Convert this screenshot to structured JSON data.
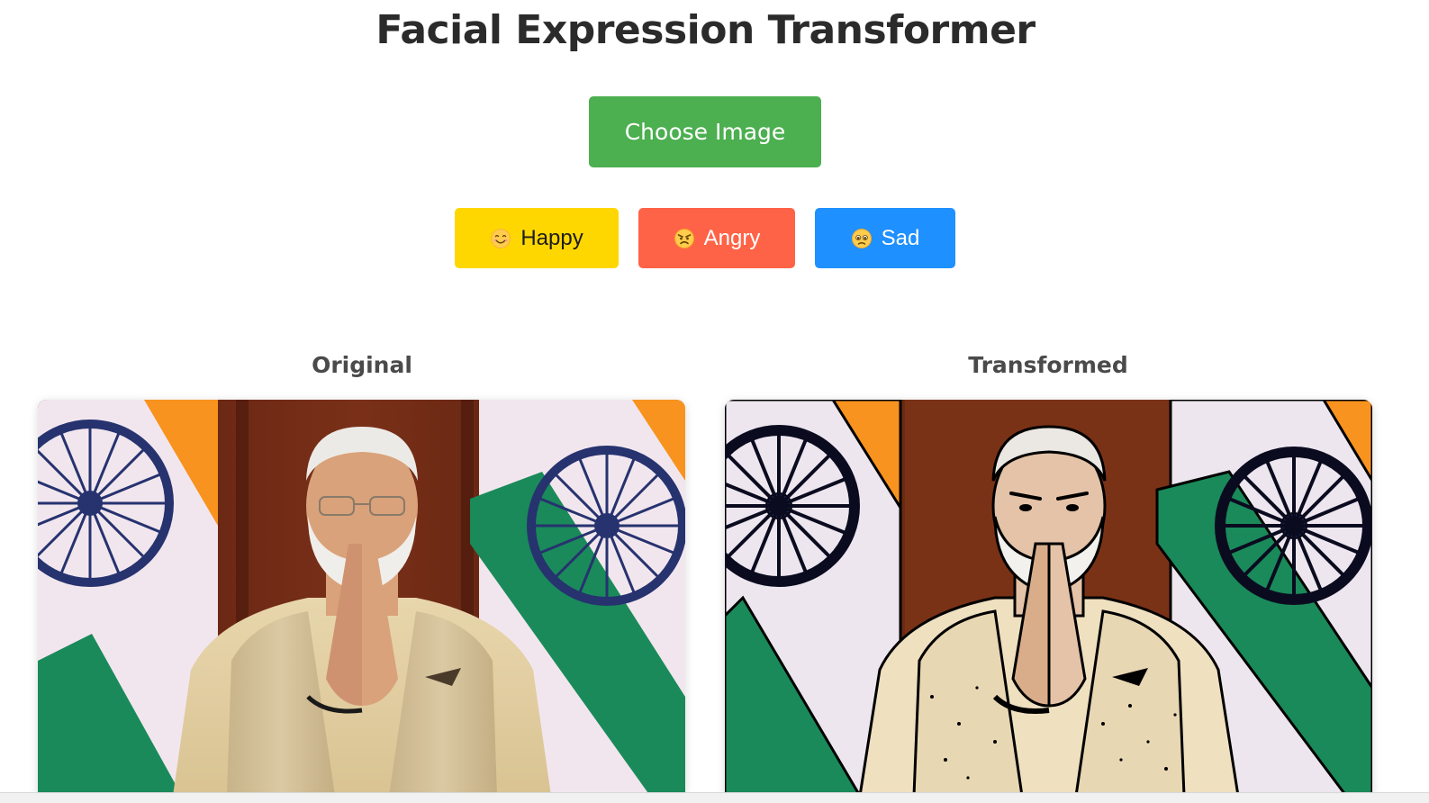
{
  "page": {
    "title": "Facial Expression Transformer"
  },
  "upload": {
    "choose_label": "Choose Image"
  },
  "expressions": [
    {
      "emoji": "smiling-face-icon",
      "label": "Happy",
      "color": "#ffd700"
    },
    {
      "emoji": "angry-face-icon",
      "label": "Angry",
      "color": "#ff6347"
    },
    {
      "emoji": "sad-face-icon",
      "label": "Sad",
      "color": "#1e90ff"
    }
  ],
  "panels": {
    "original_heading": "Original",
    "transformed_heading": "Transformed"
  },
  "colors": {
    "primary_button": "#4caf50",
    "saffron": "#f7931e",
    "india_green": "#138808",
    "chakra_blue": "#1c2a6b"
  }
}
